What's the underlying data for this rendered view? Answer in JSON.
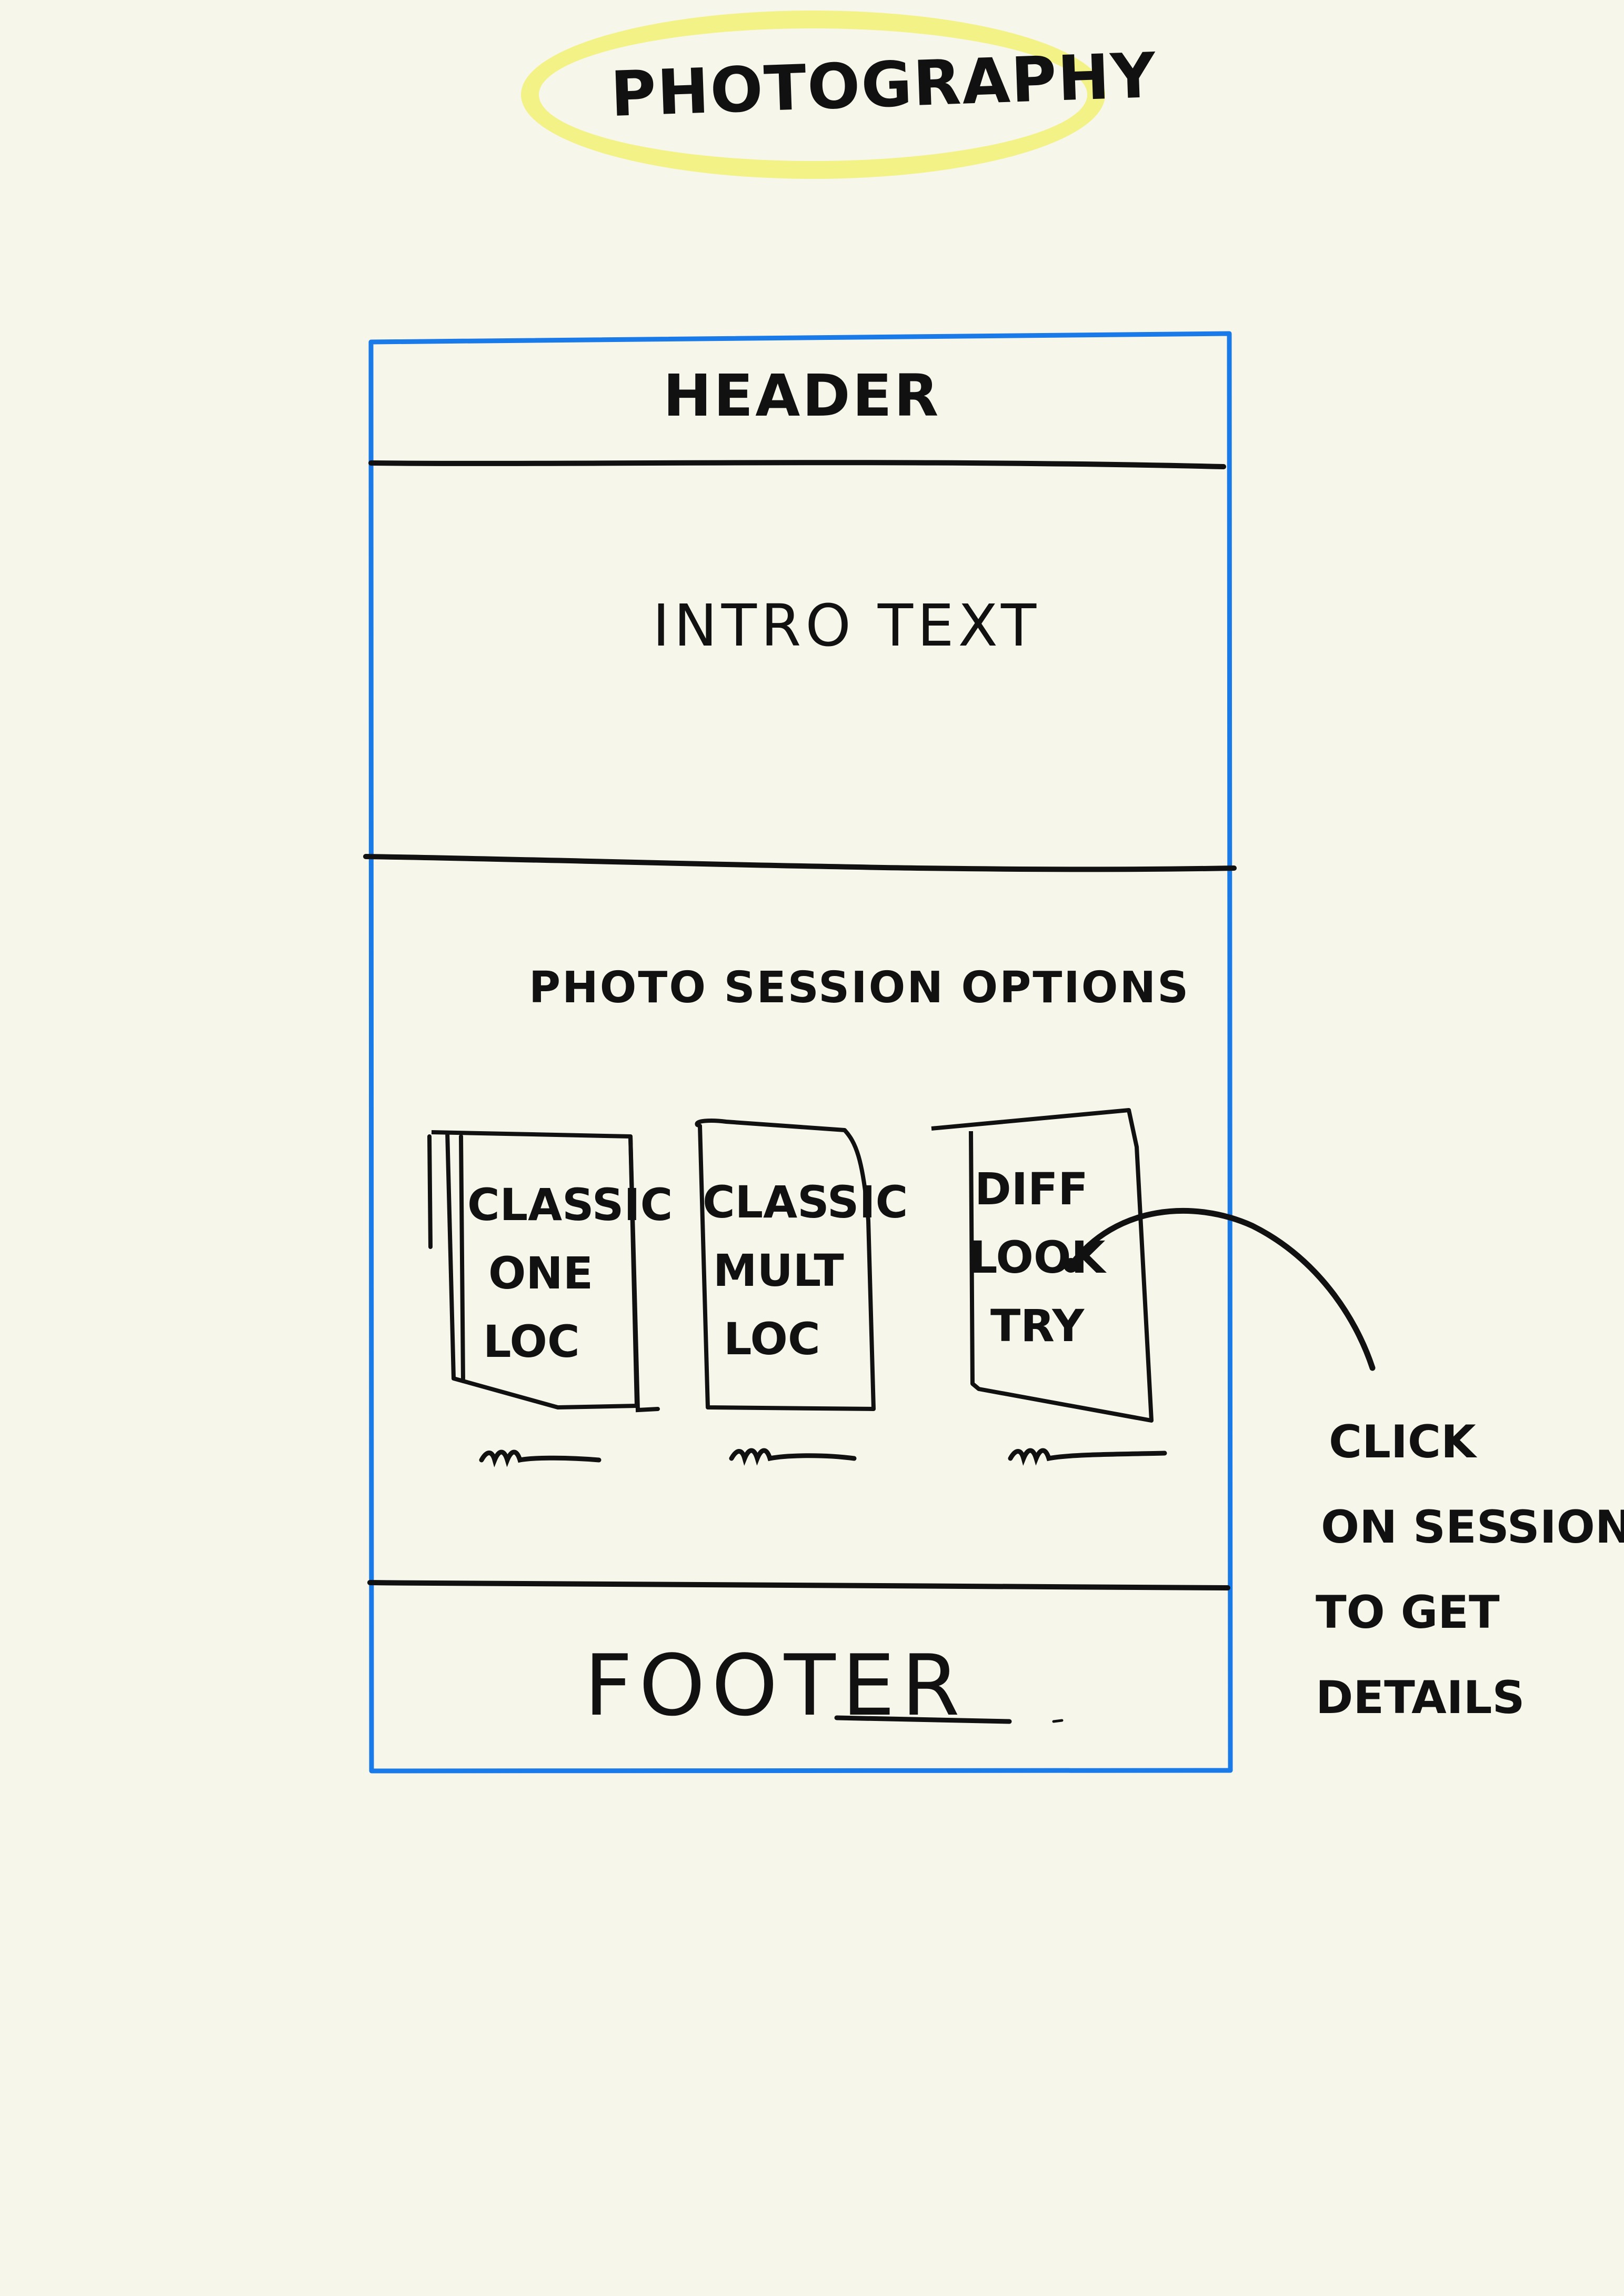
{
  "title": "PHOTOGRAPHY",
  "title_highlight_color": "#f3f286",
  "frame_color": "#1a7ae8",
  "ink_color": "#111111",
  "background_color": "#f7f6eb",
  "wireframe": {
    "header": "HEADER",
    "intro": "INTRO TEXT",
    "sessions_heading": "PHOTO SESSION OPTIONS",
    "cards": [
      {
        "line1": "CLASSIC",
        "line2": "ONE",
        "line3": "LOC"
      },
      {
        "line1": "CLASSIC",
        "line2": "MULT",
        "line3": "LOC"
      },
      {
        "line1": "DIFF",
        "line2": "LOOK",
        "line3": "TRY"
      }
    ],
    "footer": "FOOTER"
  },
  "annotation": {
    "line1": "CLICK",
    "line2": "ON SESSION",
    "line3": "TO GET",
    "line4": "DETAILS"
  }
}
